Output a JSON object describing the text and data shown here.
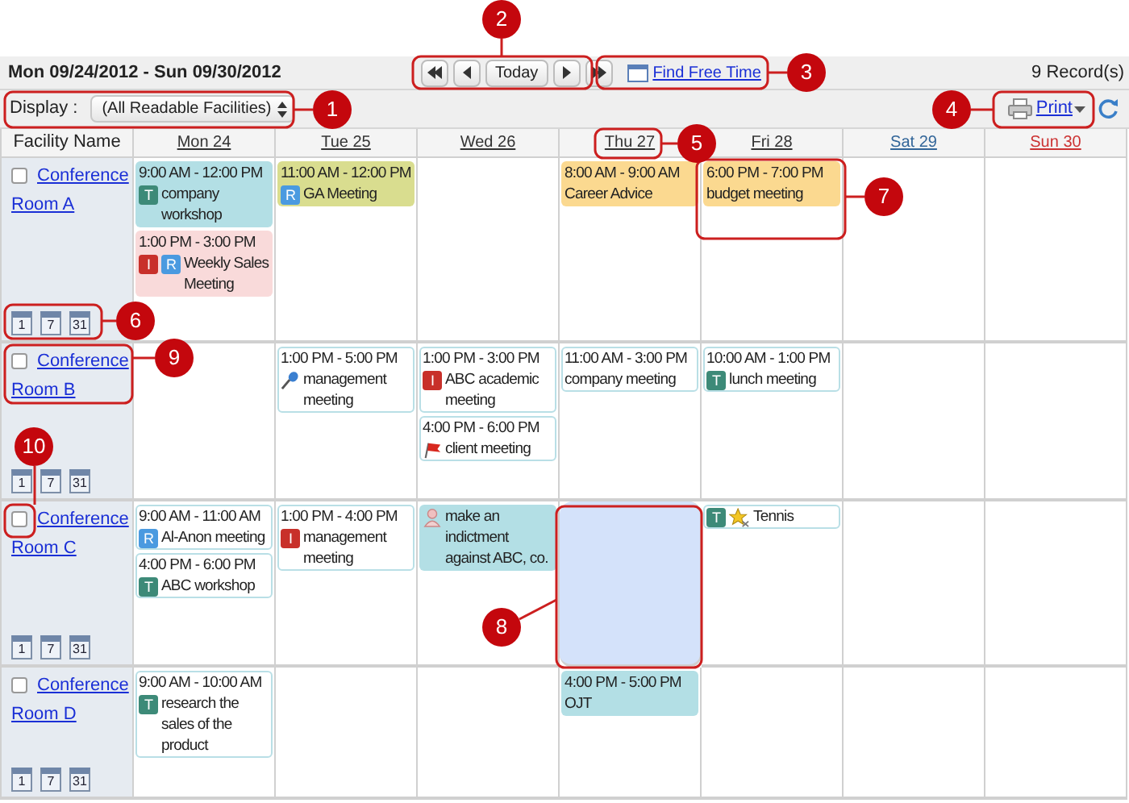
{
  "toolbar": {
    "date_range": "Mon 09/24/2012 - Sun 09/30/2012",
    "today_button": "Today",
    "find_free_time": "Find Free Time",
    "record_count": "9 Record(s)"
  },
  "filter": {
    "label": "Display :",
    "value": "(All Readable Facilities)",
    "print": "Print"
  },
  "columns": {
    "facility": "Facility Name",
    "days": [
      {
        "label": "Mon 24",
        "color": "#333333"
      },
      {
        "label": "Tue 25",
        "color": "#333333"
      },
      {
        "label": "Wed 26",
        "color": "#333333"
      },
      {
        "label": "Thu 27",
        "color": "#333333"
      },
      {
        "label": "Fri 28",
        "color": "#333333"
      },
      {
        "label": "Sat 29",
        "color": "#336699"
      },
      {
        "label": "Sun 30",
        "color": "#cc3333"
      }
    ]
  },
  "rows": [
    {
      "name": "Conference Room A",
      "checked": false,
      "view_buttons": [
        "1",
        "7",
        "31"
      ],
      "cells": [
        {
          "selected": false,
          "events": [
            {
              "kind": "filled",
              "color": "#b3dfe5",
              "time": "9:00 AM - 12:00 PM",
              "marks": [
                {
                  "kind": "letter",
                  "text": "T",
                  "color": "#3d8a78"
                }
              ],
              "title": "company workshop"
            },
            {
              "kind": "filled",
              "color": "#f9dada",
              "time": "1:00 PM - 3:00 PM",
              "marks": [
                {
                  "kind": "letter",
                  "text": "I",
                  "color": "#c8302a"
                },
                {
                  "kind": "letter",
                  "text": "R",
                  "color": "#4a9ae0"
                }
              ],
              "title": "Weekly Sales Meeting"
            }
          ]
        },
        {
          "selected": false,
          "events": [
            {
              "kind": "filled",
              "color": "#d9dd8f",
              "time": "11:00 AM - 12:00 PM",
              "marks": [
                {
                  "kind": "letter",
                  "text": "R",
                  "color": "#4a9ae0"
                }
              ],
              "title": "GA Meeting"
            }
          ]
        },
        {
          "selected": false
        },
        {
          "selected": false,
          "events": [
            {
              "kind": "filled",
              "color": "#fbd990",
              "time": "8:00 AM - 9:00 AM",
              "title": "Career Advice"
            }
          ]
        },
        {
          "selected": false,
          "events": [
            {
              "kind": "filled",
              "color": "#fbd990",
              "time": "6:00 PM - 7:00 PM",
              "title": "budget meeting"
            }
          ]
        },
        {
          "selected": false
        },
        {
          "selected": false
        }
      ]
    },
    {
      "name": "Conference Room B",
      "checked": false,
      "view_buttons": [
        "1",
        "7",
        "31"
      ],
      "cells": [
        {
          "selected": false
        },
        {
          "selected": false,
          "events": [
            {
              "kind": "outlined",
              "color": "#ffffff",
              "time": "1:00 PM - 5:00 PM",
              "marks": [
                {
                  "kind": "microphone"
                }
              ],
              "title": "management meeting"
            }
          ]
        },
        {
          "selected": false,
          "events": [
            {
              "kind": "outlined",
              "color": "#ffffff",
              "time": "1:00 PM - 3:00 PM",
              "marks": [
                {
                  "kind": "letter",
                  "text": "I",
                  "color": "#c8302a"
                }
              ],
              "title": "ABC academic meeting"
            },
            {
              "kind": "outlined",
              "color": "#ffffff",
              "time": "4:00 PM - 6:00 PM",
              "marks": [
                {
                  "kind": "flag"
                }
              ],
              "title": "client meeting"
            }
          ]
        },
        {
          "selected": false,
          "events": [
            {
              "kind": "outlined",
              "color": "#ffffff",
              "time": "11:00 AM - 3:00 PM",
              "title": "company meeting"
            }
          ]
        },
        {
          "selected": false,
          "events": [
            {
              "kind": "outlined",
              "color": "#ffffff",
              "time": "10:00 AM - 1:00 PM",
              "marks": [
                {
                  "kind": "letter",
                  "text": "T",
                  "color": "#3d8a78"
                }
              ],
              "title": "lunch meeting"
            }
          ]
        },
        {
          "selected": false
        },
        {
          "selected": false
        }
      ]
    },
    {
      "name": "Conference Room C",
      "checked": false,
      "view_buttons": [
        "1",
        "7",
        "31"
      ],
      "cells": [
        {
          "selected": false,
          "events": [
            {
              "kind": "outlined",
              "color": "#ffffff",
              "time": "9:00 AM - 11:00 AM",
              "marks": [
                {
                  "kind": "letter",
                  "text": "R",
                  "color": "#4a9ae0"
                }
              ],
              "title": "Al-Anon meeting"
            },
            {
              "kind": "outlined",
              "color": "#ffffff",
              "time": "4:00 PM - 6:00 PM",
              "marks": [
                {
                  "kind": "letter",
                  "text": "T",
                  "color": "#3d8a78"
                }
              ],
              "title": "ABC workshop"
            }
          ]
        },
        {
          "selected": false,
          "events": [
            {
              "kind": "outlined",
              "color": "#ffffff",
              "time": "1:00 PM - 4:00 PM",
              "marks": [
                {
                  "kind": "letter",
                  "text": "I",
                  "color": "#c8302a"
                }
              ],
              "title": "management meeting"
            }
          ]
        },
        {
          "selected": false,
          "events": [
            {
              "kind": "filled",
              "color": "#b3dfe5",
              "marks": [
                {
                  "kind": "person"
                }
              ],
              "title": "make an indictment against ABC, co."
            }
          ]
        },
        {
          "selected": true
        },
        {
          "selected": false,
          "events": [
            {
              "kind": "outlined",
              "color": "#ffffff",
              "marks": [
                {
                  "kind": "letter",
                  "text": "T",
                  "color": "#3d8a78"
                },
                {
                  "kind": "star"
                }
              ],
              "title": "Tennis"
            }
          ]
        },
        {
          "selected": false
        },
        {
          "selected": false
        }
      ]
    },
    {
      "name": "Conference Room D",
      "checked": false,
      "view_buttons": [
        "1",
        "7",
        "31"
      ],
      "cells": [
        {
          "selected": false,
          "events": [
            {
              "kind": "outlined",
              "color": "#ffffff",
              "time": "9:00 AM - 10:00 AM",
              "marks": [
                {
                  "kind": "letter",
                  "text": "T",
                  "color": "#3d8a78"
                }
              ],
              "title": "research the sales of the product"
            }
          ]
        },
        {
          "selected": false
        },
        {
          "selected": false
        },
        {
          "selected": false,
          "events": [
            {
              "kind": "filled",
              "color": "#b3dfe5",
              "time": "4:00 PM - 5:00 PM",
              "title": "OJT"
            }
          ]
        },
        {
          "selected": false
        },
        {
          "selected": false
        },
        {
          "selected": false
        }
      ]
    }
  ],
  "callouts": [
    "1",
    "2",
    "3",
    "4",
    "5",
    "6",
    "7",
    "8",
    "9",
    "10"
  ]
}
